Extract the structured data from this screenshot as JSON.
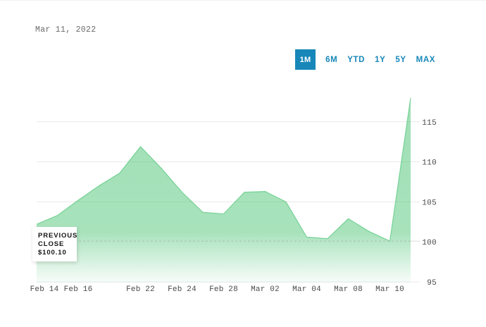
{
  "page": {
    "date_label": "Mar 11, 2022"
  },
  "range_selector": {
    "options": [
      {
        "label": "1M",
        "selected": true
      },
      {
        "label": "6M",
        "selected": false
      },
      {
        "label": "YTD",
        "selected": false
      },
      {
        "label": "1Y",
        "selected": false
      },
      {
        "label": "5Y",
        "selected": false
      },
      {
        "label": "MAX",
        "selected": false
      }
    ]
  },
  "previous_close_flag": {
    "line1": "PREVIOUS",
    "line2": "CLOSE",
    "line3": "$100.10"
  },
  "colors": {
    "accent_teal": "#1787b9",
    "area_green": "#40c06c",
    "grid_line": "#e9e9e9",
    "dashed_line": "#b3b9b4",
    "tick_text": "#484848",
    "date_text": "#6d6d6d"
  },
  "chart_data": {
    "type": "area",
    "title": "1 month stock price chart",
    "x": [
      "Feb 14",
      "Feb 15",
      "Feb 16",
      "Feb 17",
      "Feb 18",
      "Feb 22",
      "Feb 23",
      "Feb 24",
      "Feb 25",
      "Feb 28",
      "Mar 01",
      "Mar 02",
      "Mar 03",
      "Mar 04",
      "Mar 07",
      "Mar 08",
      "Mar 09",
      "Mar 10",
      "Mar 11"
    ],
    "values": [
      102.2,
      103.3,
      105.2,
      107.0,
      108.6,
      111.9,
      109.2,
      106.2,
      103.7,
      103.5,
      106.2,
      106.3,
      105.0,
      100.6,
      100.4,
      102.9,
      101.3,
      100.1,
      118.0
    ],
    "x_tick_labels": [
      "Feb 14",
      "Feb 16",
      "Feb 22",
      "Feb 24",
      "Feb 28",
      "Mar 02",
      "Mar 04",
      "Mar 08",
      "Mar 10"
    ],
    "x_tick_indices": [
      0,
      2,
      5,
      7,
      9,
      11,
      13,
      15,
      17
    ],
    "y_ticks": [
      95,
      100,
      105,
      110,
      115
    ],
    "ylim": [
      95,
      119.5
    ],
    "previous_close": 100.1,
    "grid": true,
    "legend": "none",
    "xlabel": "",
    "ylabel": ""
  }
}
